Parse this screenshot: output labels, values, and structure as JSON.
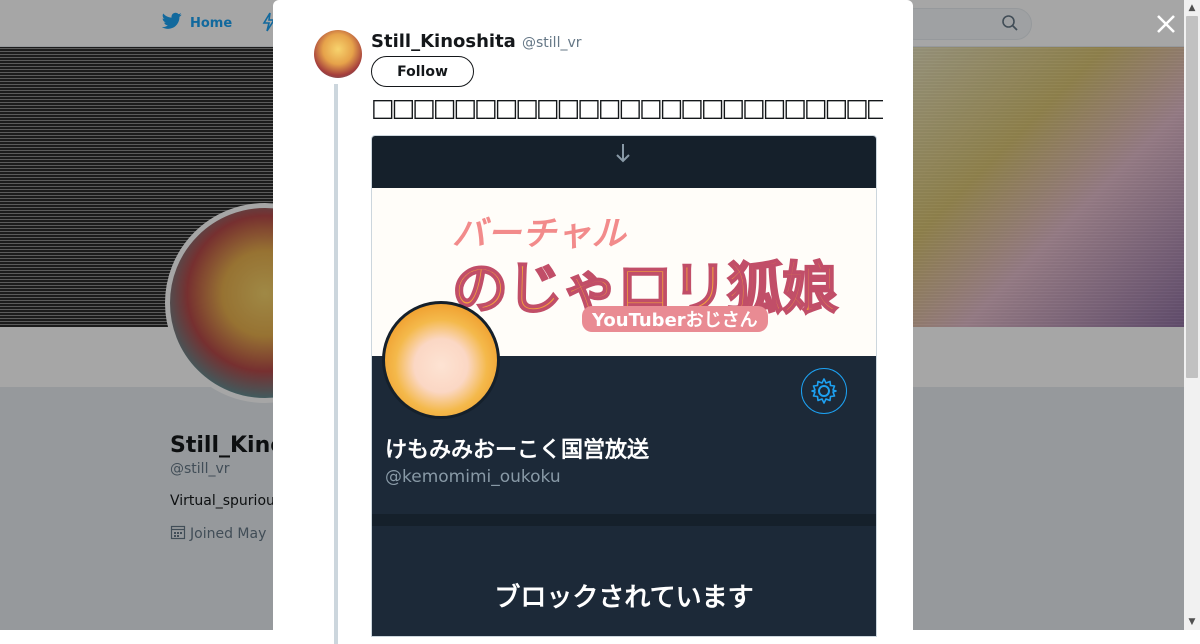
{
  "background": {
    "nav": {
      "home_label": "Home"
    },
    "profile": {
      "name": "Still_Kino",
      "handle": "@still_vr",
      "bio": "Virtual_spuriou",
      "joined": "Joined May"
    }
  },
  "tweet": {
    "author_name": "Still_Kinoshita",
    "author_handle": "@still_vr",
    "follow_label": "Follow",
    "text": "□□□□□□□□□□□□□□□□□□□□□□□□□□□□□□□□□□□□□□□□□□□□□□□□□□",
    "media": {
      "banner_line1": "バーチャル",
      "banner_line2": "のじゃロリ狐娘",
      "banner_line3": "YouTuberおじさん",
      "account_name": "けもみみおーこく国営放送",
      "account_handle": "@kemomimi_oukoku",
      "blocked_title": "ブロックされています"
    }
  },
  "colors": {
    "twitter_blue": "#1da1f2",
    "dark_card": "#1c2938",
    "dark_bg": "#15202b"
  },
  "icons": [
    "twitter-bird-icon",
    "moments-icon",
    "search-icon",
    "close-icon",
    "arrow-down-icon",
    "gear-icon",
    "calendar-icon"
  ]
}
